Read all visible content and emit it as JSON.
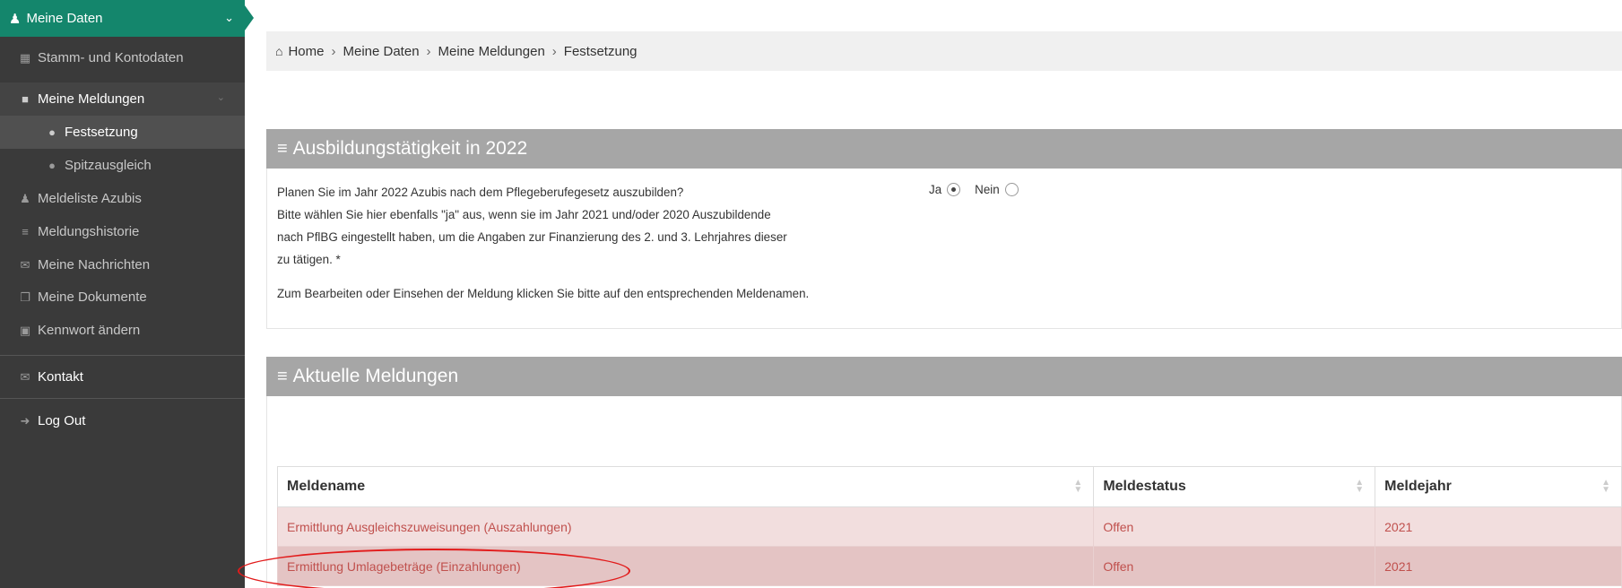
{
  "sidebar": {
    "header_label": "Meine Daten",
    "items": [
      {
        "label": "Stamm- und Kontodaten",
        "icon": "calendar-icon"
      },
      {
        "label": "Meine Meldungen",
        "icon": "folder-icon"
      },
      {
        "label": "Festsetzung",
        "icon": "info-icon"
      },
      {
        "label": "Spitzausgleich",
        "icon": "info-icon"
      },
      {
        "label": "Meldeliste Azubis",
        "icon": "users-icon"
      },
      {
        "label": "Meldungshistorie",
        "icon": "list-icon"
      },
      {
        "label": "Meine Nachrichten",
        "icon": "envelope-icon"
      },
      {
        "label": "Meine Dokumente",
        "icon": "documents-icon"
      },
      {
        "label": "Kennwort ändern",
        "icon": "lock-icon"
      }
    ],
    "contact_label": "Kontakt",
    "logout_label": "Log Out"
  },
  "breadcrumb": {
    "items": [
      "Home",
      "Meine Daten",
      "Meine Meldungen",
      "Festsetzung"
    ]
  },
  "section1": {
    "title": "Ausbildungstätigkeit in 2022",
    "question_lines": [
      "Planen Sie im Jahr 2022 Azubis nach dem Pflegeberufegesetz auszubilden?",
      "Bitte wählen Sie hier ebenfalls \"ja\" aus, wenn sie im Jahr 2021 und/oder 2020 Auszubildende",
      "nach PflBG eingestellt haben, um die Angaben zur Finanzierung des 2. und 3. Lehrjahres dieser",
      "zu tätigen. *"
    ],
    "radio_yes": "Ja",
    "radio_no": "Nein",
    "selected": "Ja",
    "note": "Zum Bearbeiten oder Einsehen der Meldung klicken Sie bitte auf den entsprechenden Meldenamen."
  },
  "section2": {
    "title": "Aktuelle Meldungen",
    "columns": [
      "Meldename",
      "Meldestatus",
      "Meldejahr"
    ],
    "rows": [
      [
        "Ermittlung Ausgleichszuweisungen (Auszahlungen)",
        "Offen",
        "2021"
      ],
      [
        "Ermittlung Umlagebeträge (Einzahlungen)",
        "Offen",
        "2021"
      ]
    ]
  },
  "colors": {
    "sidebar_bg": "#3a3a3a",
    "accent_green": "#14866c",
    "panel_header": "#a6a6a6",
    "row_text": "#c0504d",
    "highlight": "#e21b1b"
  }
}
